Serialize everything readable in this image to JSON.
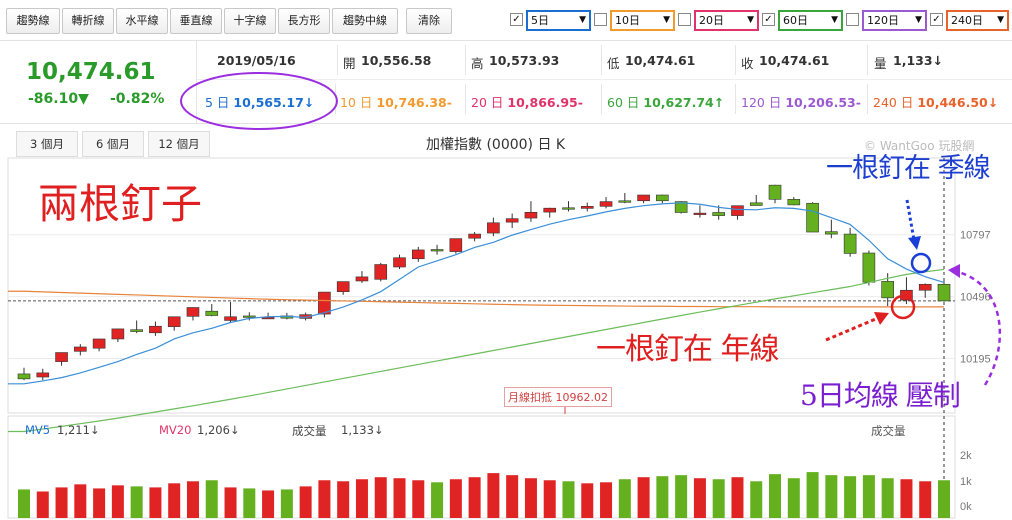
{
  "toolbar": {
    "buttons": [
      "趨勢線",
      "轉折線",
      "水平線",
      "垂直線",
      "十字線",
      "長方形",
      "趨勢中線",
      "清除"
    ],
    "ma_options": [
      {
        "label": "5日",
        "checked": true,
        "color": "#1a6fd1"
      },
      {
        "label": "10日",
        "checked": false,
        "color": "#f39a2e"
      },
      {
        "label": "20日",
        "checked": false,
        "color": "#e0336a"
      },
      {
        "label": "60日",
        "checked": true,
        "color": "#3aa53a"
      },
      {
        "label": "120日",
        "checked": false,
        "color": "#9b59d0"
      },
      {
        "label": "240日",
        "checked": true,
        "color": "#e8622c"
      }
    ]
  },
  "quote": {
    "price": "10,474.61",
    "change": "-86.10▼",
    "change_pct": "-0.82%",
    "date": "2019/05/16",
    "open_label": "開",
    "open": "10,556.58",
    "high_label": "高",
    "high": "10,573.93",
    "low_label": "低",
    "low": "10,474.61",
    "close_label": "收",
    "close": "10,474.61",
    "volume_label": "量",
    "volume": "1,133↓"
  },
  "ma_values": [
    {
      "label": "5 日",
      "value": "10,565.17↓",
      "color": "#1a6fd1"
    },
    {
      "label": "10 日",
      "value": "10,746.38-",
      "color": "#f39a2e"
    },
    {
      "label": "20 日",
      "value": "10,866.95-",
      "color": "#e0336a"
    },
    {
      "label": "60 日",
      "value": "10,627.74↑",
      "color": "#3aa53a"
    },
    {
      "label": "120 日",
      "value": "10,206.53-",
      "color": "#9b59d0"
    },
    {
      "label": "240 日",
      "value": "10,446.50↓",
      "color": "#e8622c"
    }
  ],
  "range_buttons": [
    "3 個月",
    "6 個月",
    "12 個月"
  ],
  "chart_title": "加權指數 (0000) 日 K",
  "watermark": "© WantGoo 玩股網",
  "volume_labels": {
    "mv5_label": "MV5",
    "mv5": "1,211↓",
    "mv20_label": "MV20",
    "mv20": "1,206↓",
    "vol_label": "成交量",
    "vol": "1,133↓",
    "right_label": "成交量"
  },
  "annotations": {
    "title": "兩根釘子",
    "season": "一根釘在 季線",
    "year": "一根釘在 年線",
    "ma5": "5日均線 壓制",
    "monthly": "月線扣抵 10962.02"
  },
  "colors": {
    "up": "#e02424",
    "down": "#64b01e",
    "ma5": "#3a8fd8",
    "ma60": "#6cbd5b",
    "ma240": "#e8833a"
  },
  "chart_data": {
    "type": "candlestick",
    "title": "加權指數 (0000) 日 K",
    "y_ticks": [
      10797,
      10496,
      10195
    ],
    "ylim": [
      9930,
      11170
    ],
    "open": [
      10120,
      10105,
      10180,
      10230,
      10245,
      10290,
      10335,
      10320,
      10350,
      10400,
      10425,
      10380,
      10402,
      10392,
      10402,
      10390,
      10411,
      10520,
      10572,
      10580,
      10640,
      10680,
      10725,
      10715,
      10780,
      10805,
      10858,
      10878,
      10907,
      10928,
      10925,
      10935,
      10962,
      10962,
      10990,
      10958,
      10902,
      10905,
      10890,
      10952,
      11038,
      10969,
      10950,
      10812,
      10800,
      10708,
      10570,
      10479,
      10527,
      10556
    ],
    "high": [
      10150,
      10145,
      10215,
      10265,
      10290,
      10340,
      10380,
      10375,
      10395,
      10440,
      10460,
      10470,
      10420,
      10418,
      10417,
      10418,
      10450,
      10560,
      10620,
      10660,
      10700,
      10738,
      10748,
      10770,
      10810,
      10880,
      10900,
      10960,
      10928,
      10960,
      10953,
      10980,
      11000,
      10980,
      10992,
      10960,
      10940,
      10940,
      10930,
      10990,
      11040,
      10980,
      10955,
      10870,
      10830,
      10720,
      10610,
      10590,
      10560,
      10574
    ],
    "low": [
      10090,
      10090,
      10160,
      10210,
      10230,
      10275,
      10318,
      10305,
      10330,
      10380,
      10400,
      10370,
      10380,
      10390,
      10385,
      10380,
      10395,
      10505,
      10562,
      10570,
      10630,
      10665,
      10700,
      10705,
      10765,
      10790,
      10830,
      10860,
      10880,
      10910,
      10910,
      10925,
      10950,
      10950,
      10950,
      10900,
      10880,
      10870,
      10870,
      10940,
      10950,
      10940,
      10810,
      10780,
      10690,
      10550,
      10450,
      10460,
      10490,
      10475
    ],
    "close": [
      10096,
      10125,
      10224,
      10251,
      10290,
      10339,
      10326,
      10352,
      10398,
      10443,
      10404,
      10398,
      10398,
      10395,
      10391,
      10408,
      10518,
      10569,
      10592,
      10652,
      10685,
      10723,
      10720,
      10778,
      10800,
      10855,
      10875,
      10906,
      10926,
      10927,
      10935,
      10958,
      10957,
      10990,
      10962,
      10905,
      10902,
      10890,
      10938,
      10939,
      10969,
      10942,
      10810,
      10800,
      10706,
      10566,
      10490,
      10527,
      10556,
      10475
    ],
    "ma5": [
      10072,
      10086,
      10102,
      10125,
      10152,
      10180,
      10215,
      10245,
      10290,
      10320,
      10342,
      10370,
      10390,
      10398,
      10400,
      10395,
      10418,
      10445,
      10480,
      10520,
      10580,
      10640,
      10670,
      10700,
      10735,
      10760,
      10795,
      10822,
      10848,
      10870,
      10888,
      10908,
      10925,
      10938,
      10947,
      10952,
      10945,
      10930,
      10920,
      10918,
      10928,
      10925,
      10912,
      10880,
      10847,
      10770,
      10680,
      10630,
      10593,
      10565
    ],
    "ma60": [
      9840,
      9852,
      9865,
      9878,
      9891,
      9905,
      9920,
      9935,
      9950,
      9965,
      9981,
      9997,
      10013,
      10030,
      10047,
      10064,
      10081,
      10098,
      10115,
      10132,
      10149,
      10166,
      10183,
      10200,
      10217,
      10234,
      10251,
      10268,
      10285,
      10302,
      10319,
      10336,
      10353,
      10370,
      10387,
      10404,
      10421,
      10437,
      10453,
      10469,
      10485,
      10500,
      10515,
      10530,
      10545,
      10565,
      10585,
      10604,
      10617,
      10628
    ],
    "ma240": [
      10522,
      10519,
      10516,
      10513,
      10510,
      10507,
      10504,
      10501,
      10498,
      10495,
      10492,
      10489,
      10486,
      10483,
      10481,
      10479,
      10477,
      10475,
      10473,
      10471,
      10469,
      10467,
      10465,
      10463,
      10461,
      10459,
      10457,
      10455,
      10454,
      10453,
      10452,
      10451,
      10450,
      10449,
      10449,
      10448,
      10448,
      10447,
      10447,
      10447,
      10446,
      10446,
      10446,
      10446,
      10446,
      10446,
      10446,
      10446,
      10446,
      10446
    ],
    "volume_levels": [
      0.28,
      0.26,
      0.3,
      0.33,
      0.29,
      0.32,
      0.31,
      0.3,
      0.34,
      0.36,
      0.37,
      0.3,
      0.29,
      0.27,
      0.28,
      0.31,
      0.37,
      0.36,
      0.38,
      0.4,
      0.39,
      0.37,
      0.35,
      0.38,
      0.4,
      0.44,
      0.42,
      0.39,
      0.37,
      0.36,
      0.34,
      0.35,
      0.38,
      0.4,
      0.41,
      0.42,
      0.39,
      0.38,
      0.4,
      0.36,
      0.43,
      0.39,
      0.45,
      0.42,
      0.41,
      0.42,
      0.39,
      0.38,
      0.36,
      0.37
    ],
    "volume_ticks": [
      "2k",
      "1k",
      "0k"
    ]
  }
}
